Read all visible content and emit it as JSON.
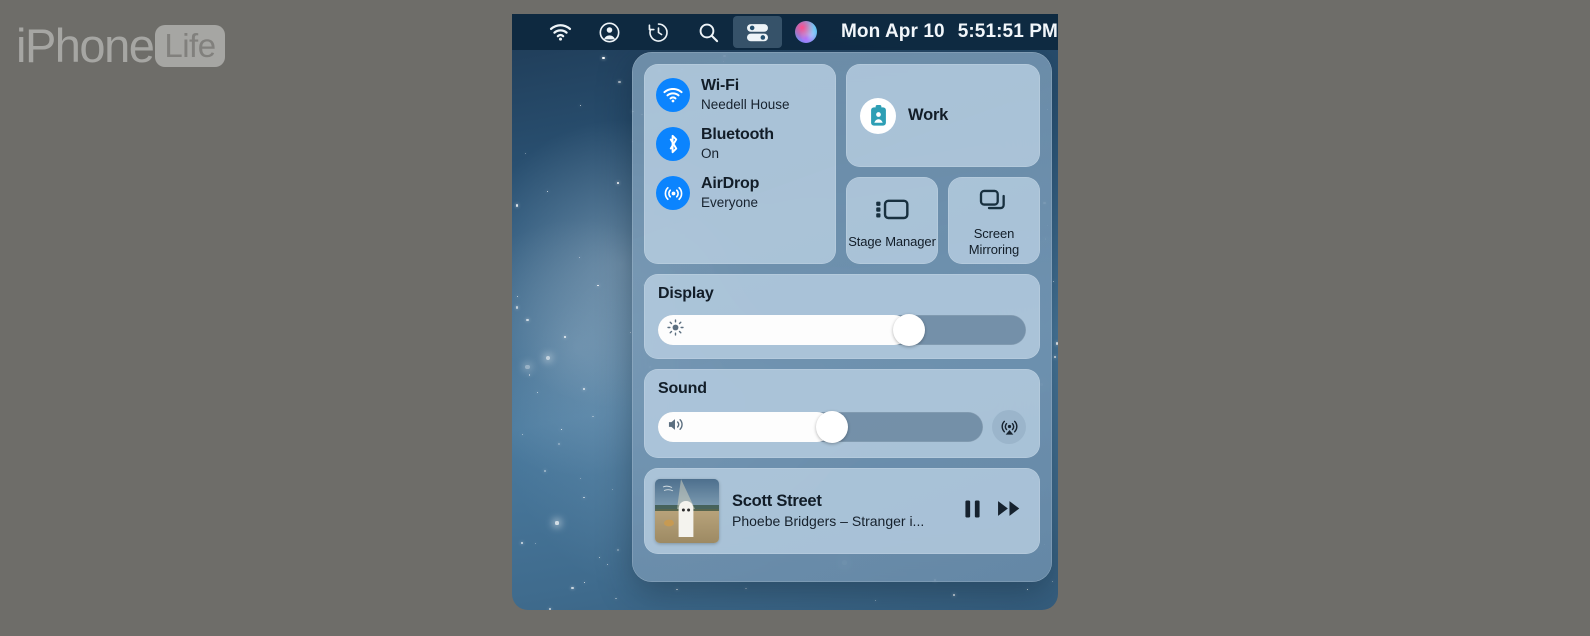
{
  "watermark": {
    "part1": "iPhone",
    "part2": "Life"
  },
  "menubar": {
    "items": [
      {
        "name": "wifi-icon",
        "label": "Wi-Fi"
      },
      {
        "name": "user-account-icon",
        "label": "User"
      },
      {
        "name": "time-machine-icon",
        "label": "Time Machine"
      },
      {
        "name": "spotlight-search-icon",
        "label": "Search"
      },
      {
        "name": "control-center-icon",
        "label": "Control Center"
      },
      {
        "name": "siri-icon",
        "label": "Siri"
      }
    ],
    "date": "Mon Apr 10",
    "time": "5:51:51 PM"
  },
  "control_center": {
    "connectivity": [
      {
        "title": "Wi-Fi",
        "subtitle": "Needell House",
        "icon": "wifi-icon",
        "active": true
      },
      {
        "title": "Bluetooth",
        "subtitle": "On",
        "icon": "bluetooth-icon",
        "active": true
      },
      {
        "title": "AirDrop",
        "subtitle": "Everyone",
        "icon": "airdrop-icon",
        "active": true
      }
    ],
    "focus": {
      "label": "Work",
      "icon": "id-badge-icon"
    },
    "tiles": [
      {
        "label": "Stage Manager",
        "icon": "stage-manager-icon"
      },
      {
        "label": "Screen Mirroring",
        "icon": "screen-mirroring-icon"
      }
    ],
    "display": {
      "title": "Display",
      "icon": "brightness-icon",
      "value_percent": 70
    },
    "sound": {
      "title": "Sound",
      "icon": "volume-icon",
      "value_percent": 54,
      "airplay_icon": "airplay-audio-icon"
    },
    "now_playing": {
      "title": "Scott Street",
      "artist": "Phoebe Bridgers – Stranger i...",
      "artwork": "album-art-stranger-in-the-alps",
      "pause_icon": "pause-icon",
      "next_icon": "fast-forward-icon"
    }
  },
  "colors": {
    "accent_blue": "#0b84fe",
    "focus_teal": "#2e9fb5",
    "panel": "#7e9eb8",
    "card": "#b9d0e2",
    "text_dark": "#121d28",
    "menubar": "#0d283e"
  }
}
